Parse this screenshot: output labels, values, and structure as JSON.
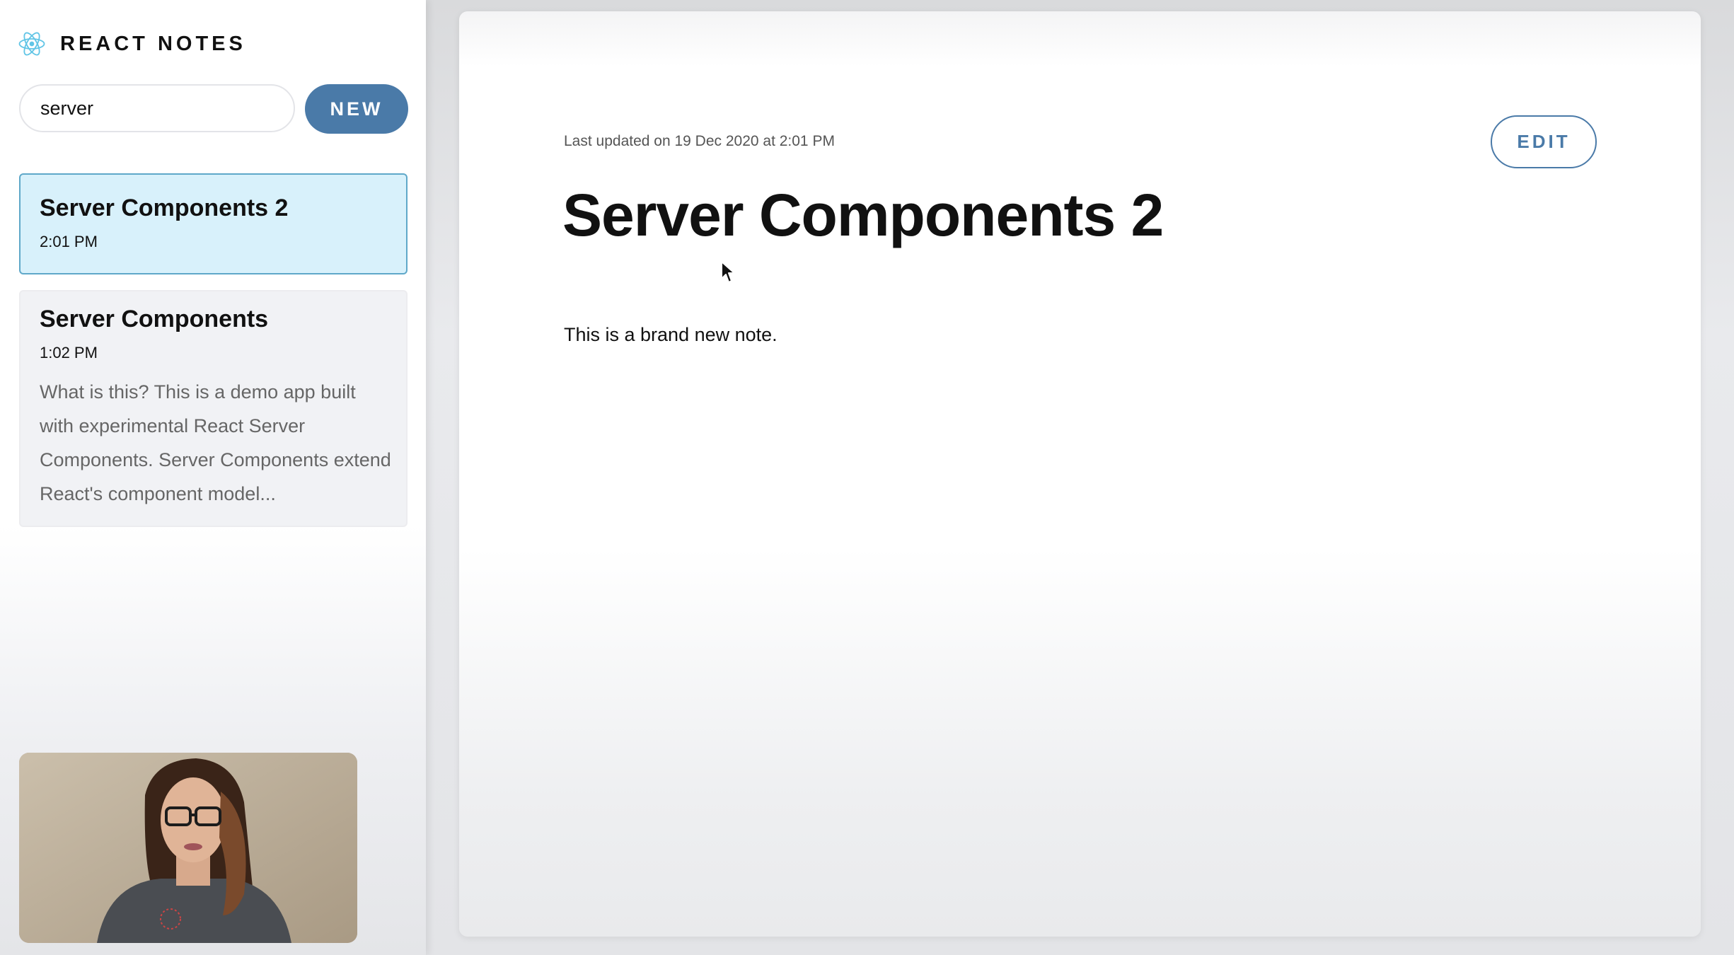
{
  "app": {
    "title": "REACT NOTES",
    "accent_color": "#4a7aa8",
    "logo_icon": "react-logo-icon"
  },
  "search": {
    "value": "server",
    "placeholder": "Search"
  },
  "toolbar": {
    "new_label": "NEW"
  },
  "notes": [
    {
      "title": "Server Components 2",
      "time": "2:01 PM",
      "excerpt": "",
      "active": true
    },
    {
      "title": "Server Components",
      "time": "1:02 PM",
      "excerpt": "What is this? This is a demo app built with experimental React Server Components. Server Components extend React's component model...",
      "active": false
    }
  ],
  "note_view": {
    "updated": "Last updated on 19 Dec 2020 at 2:01 PM",
    "edit_label": "EDIT",
    "title": "Server Components 2",
    "body": "This is a brand new note."
  }
}
